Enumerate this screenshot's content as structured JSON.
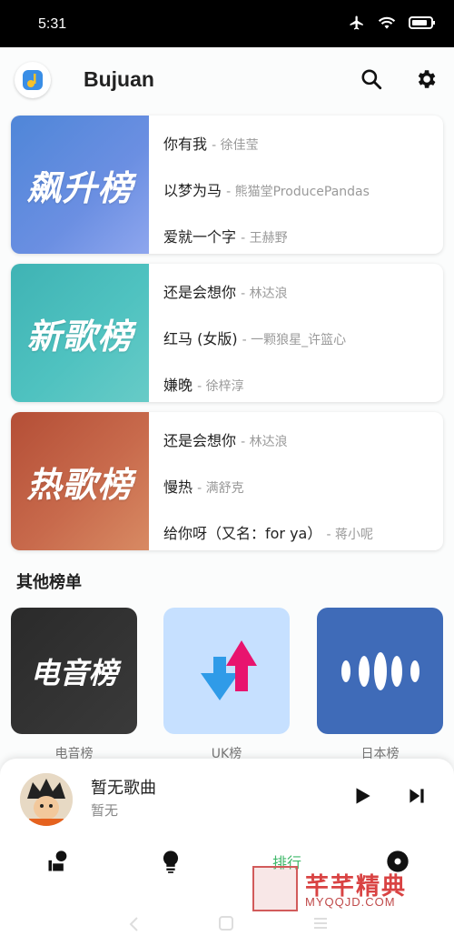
{
  "status": {
    "time": "5:31"
  },
  "app": {
    "title": "Bujuan"
  },
  "charts": [
    {
      "cover_text": "飙升榜",
      "songs": [
        {
          "title": "你有我",
          "artist": "- 徐佳莹"
        },
        {
          "title": "以梦为马",
          "artist": "- 熊猫堂ProducePandas"
        },
        {
          "title": "爱就一个字",
          "artist": "- 王赫野"
        }
      ]
    },
    {
      "cover_text": "新歌榜",
      "songs": [
        {
          "title": "还是会想你",
          "artist": "- 林达浪"
        },
        {
          "title": "红马 (女版)",
          "artist": "- 一颗狼星_许篮心"
        },
        {
          "title": "嫌晚",
          "artist": "- 徐梓淳"
        }
      ]
    },
    {
      "cover_text": "热歌榜",
      "songs": [
        {
          "title": "还是会想你",
          "artist": "- 林达浪"
        },
        {
          "title": "慢热",
          "artist": "- 满舒克"
        },
        {
          "title": "给你呀（又名：for ya）",
          "artist": "- 蒋小呢"
        }
      ]
    }
  ],
  "other_section": {
    "title": "其他榜单",
    "items": [
      {
        "cover_text": "电音榜",
        "label": "电音榜"
      },
      {
        "cover_text": "",
        "label": "UK榜"
      },
      {
        "cover_text": "",
        "label": "日本榜"
      }
    ]
  },
  "player": {
    "song": "暂无歌曲",
    "artist": "暂无"
  },
  "nav": {
    "active_label": "排行"
  },
  "watermark": {
    "cn": "芊芊精典",
    "en": "MYQQJD.COM"
  },
  "colors": {
    "accent": "#3fb86a",
    "chart_up": "#4f86d8",
    "chart_new": "#3fb3b4",
    "chart_hot": "#b44e36"
  }
}
